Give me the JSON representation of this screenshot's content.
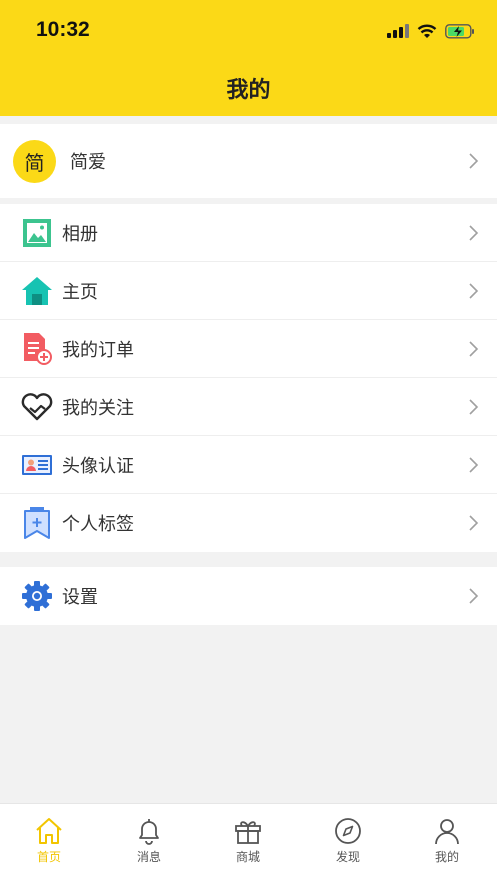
{
  "status": {
    "time": "10:32"
  },
  "nav": {
    "title": "我的"
  },
  "profile": {
    "avatar_text": "简",
    "name": "简爱"
  },
  "menu": [
    {
      "label": "相册",
      "icon": "photo-album-icon"
    },
    {
      "label": "主页",
      "icon": "home-icon"
    },
    {
      "label": "我的订单",
      "icon": "order-document-icon"
    },
    {
      "label": "我的关注",
      "icon": "heart-follow-icon"
    },
    {
      "label": "头像认证",
      "icon": "id-card-icon"
    },
    {
      "label": "个人标签",
      "icon": "bookmark-tag-icon"
    }
  ],
  "settings": {
    "label": "设置",
    "icon": "gear-icon"
  },
  "tabs": [
    {
      "label": "首页",
      "icon": "home-tab-icon",
      "active": true
    },
    {
      "label": "消息",
      "icon": "bell-icon",
      "active": false
    },
    {
      "label": "商城",
      "icon": "gift-icon",
      "active": false
    },
    {
      "label": "发现",
      "icon": "compass-icon",
      "active": false
    },
    {
      "label": "我的",
      "icon": "person-icon",
      "active": false
    }
  ],
  "colors": {
    "brand": "#fbd917",
    "active_tab": "#f2c500",
    "background": "#f2f2f2"
  }
}
